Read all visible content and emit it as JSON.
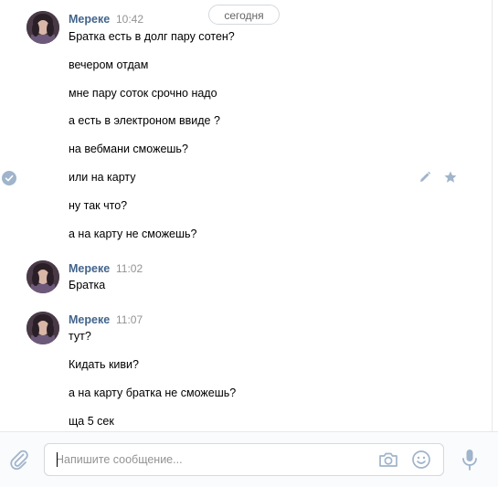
{
  "date_separator": "сегодня",
  "groups": [
    {
      "author": "Мереке",
      "time": "10:42",
      "messages": [
        "Братка есть в долг пару сотен?",
        "вечером отдам",
        "мне пару соток срочно надо",
        "а есть в электроном ввиде ?",
        "на вебмани сможешь?",
        "или на карту",
        "ну так что?",
        "а на карту не сможешь?"
      ]
    },
    {
      "author": "Мереке",
      "time": "11:02",
      "messages": [
        "Братка"
      ]
    },
    {
      "author": "Мереке",
      "time": "11:07",
      "messages": [
        "тут?",
        "Кидать киви?",
        "а на карту братка не сможешь?",
        "ща 5 сек"
      ]
    }
  ],
  "composer": {
    "placeholder": "Напишите сообщение...",
    "value": ""
  },
  "icons": {
    "attach": "paperclip-icon",
    "camera": "camera-icon",
    "emoji": "smiley-icon",
    "mic": "microphone-icon",
    "edit": "pencil-icon",
    "favorite": "star-icon",
    "select": "checkmark-icon"
  },
  "colors": {
    "author": "#42648b",
    "time": "#939393",
    "icon": "#a0b4cb",
    "check": "#a0b4cb"
  }
}
